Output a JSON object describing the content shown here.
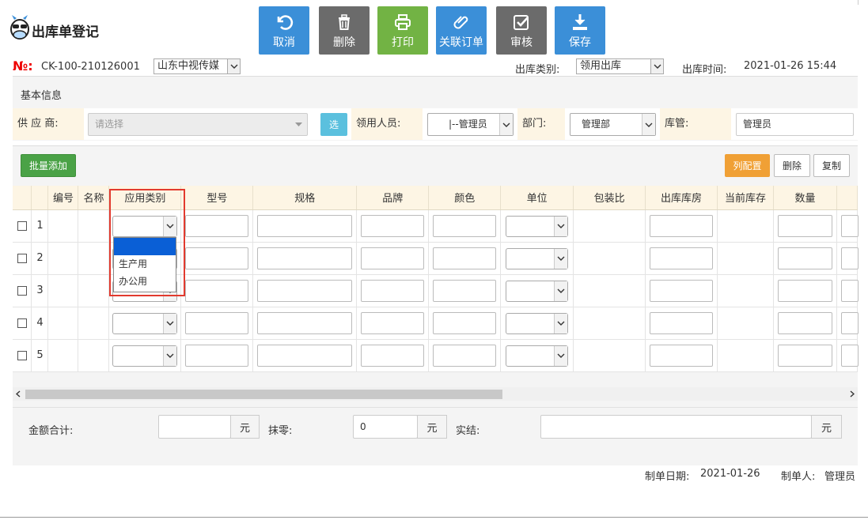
{
  "title": "出库单登记",
  "toolbar": [
    {
      "label": "取消",
      "icon": "undo-icon",
      "color": "#3b8fd8"
    },
    {
      "label": "删除",
      "icon": "trash-icon",
      "color": "#6b6b6b"
    },
    {
      "label": "打印",
      "icon": "printer-icon",
      "color": "#72b344"
    },
    {
      "label": "关联订单",
      "icon": "paperclip-icon",
      "color": "#3b8fd8"
    },
    {
      "label": "审核",
      "icon": "check-square-icon",
      "color": "#6b6b6b"
    },
    {
      "label": "保存",
      "icon": "download-icon",
      "color": "#3b8fd8"
    }
  ],
  "header": {
    "no_label": "№:",
    "no_value": "CK-100-210126001",
    "company": "山东中视传媒",
    "type_label": "出库类别:",
    "type_value": "领用出库",
    "time_label": "出库时间:",
    "time_value": "2021-01-26 15:44"
  },
  "basic": {
    "title": "基本信息",
    "supplier_label": "供 应 商:",
    "supplier_placeholder": "请选择",
    "select_button": "选",
    "receiver_label": "领用人员:",
    "receiver_value": "|--管理员",
    "dept_label": "部门:",
    "dept_value": "管理部",
    "keeper_label": "库管:",
    "keeper_value": "管理员"
  },
  "items": {
    "batch_add": "批量添加",
    "col_config": "列配置",
    "delete": "删除",
    "copy": "复制",
    "columns": [
      "编号",
      "名称",
      "应用类别",
      "型号",
      "规格",
      "品牌",
      "颜色",
      "单位",
      "包装比",
      "出库库房",
      "当前库存",
      "数量"
    ],
    "rows": [
      "1",
      "2",
      "3",
      "4",
      "5"
    ],
    "dropdown_options": [
      "",
      "生产用",
      "办公用"
    ]
  },
  "totals": {
    "amount_label": "金额合计:",
    "unit": "元",
    "rounding_label": "抹零:",
    "rounding_value": "0",
    "actual_label": "实结:"
  },
  "footer": {
    "date_label": "制单日期:",
    "date_value": "2021-01-26",
    "maker_label": "制单人:",
    "maker_value": "管理员"
  }
}
